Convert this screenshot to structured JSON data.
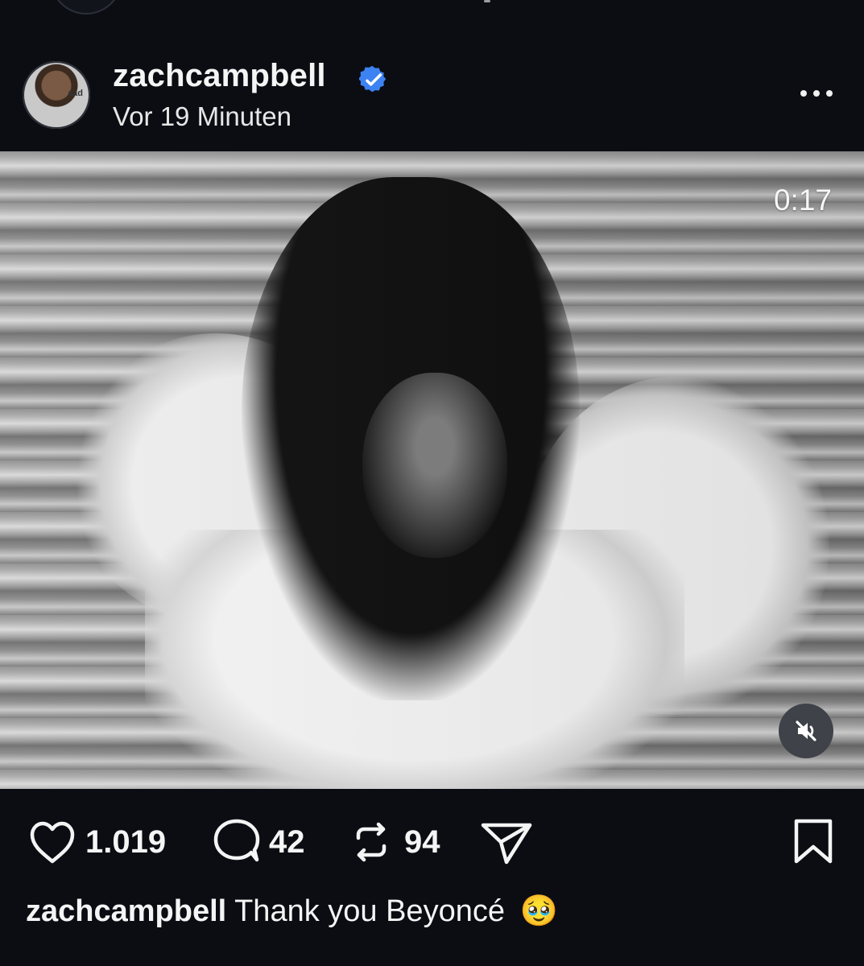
{
  "post": {
    "username": "zachcampbell",
    "verified": true,
    "timestamp": "Vor 19 Minuten",
    "avatar_text": "aad"
  },
  "video": {
    "timer": "0:17"
  },
  "actions": {
    "likes": "1.019",
    "comments": "42",
    "reposts": "94"
  },
  "caption": {
    "username": "zachcampbell",
    "text": "Thank you Beyoncé",
    "emoji": "🥹"
  },
  "colors": {
    "background": "#0b0d13",
    "verified": "#3d82f2",
    "text": "#f5f5f5"
  },
  "icons": {
    "heart": "heart-icon",
    "comment": "comment-icon",
    "repost": "repost-icon",
    "share": "send-icon",
    "bookmark": "bookmark-icon",
    "mute": "volume-mute-icon",
    "more": "more-icon"
  }
}
